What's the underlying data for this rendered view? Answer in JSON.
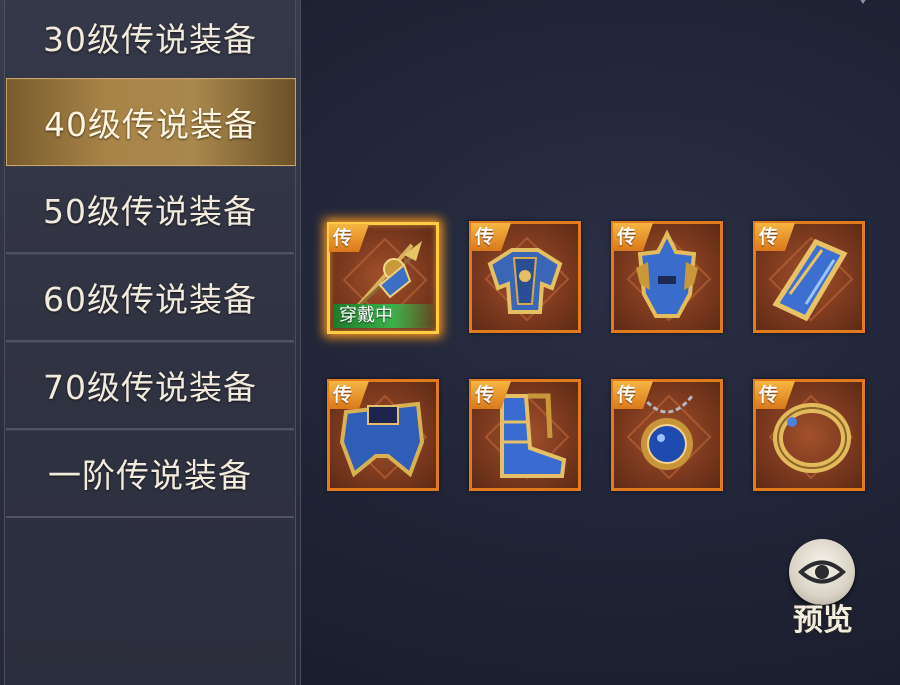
{
  "sidebar": {
    "items": [
      {
        "label": "30级传说装备",
        "selected": false
      },
      {
        "label": "40级传说装备",
        "selected": true
      },
      {
        "label": "50级传说装备",
        "selected": false
      },
      {
        "label": "60级传说装备",
        "selected": false
      },
      {
        "label": "70级传说装备",
        "selected": false
      },
      {
        "label": "一阶传说装备",
        "selected": false
      }
    ]
  },
  "equipment": {
    "badge_label": "传",
    "equipped_label": "穿戴中",
    "slots": [
      {
        "icon": "weapon-icon",
        "equipped": true
      },
      {
        "icon": "chest-armor-icon",
        "equipped": false
      },
      {
        "icon": "helmet-icon",
        "equipped": false
      },
      {
        "icon": "bracer-icon",
        "equipped": false
      },
      {
        "icon": "belt-icon",
        "equipped": false
      },
      {
        "icon": "boots-icon",
        "equipped": false
      },
      {
        "icon": "necklace-icon",
        "equipped": false
      },
      {
        "icon": "ring-icon",
        "equipped": false
      }
    ]
  },
  "preview": {
    "label": "预览",
    "icon": "eye-icon"
  },
  "colors": {
    "legend_orange": "#e27a1e",
    "selected_gold": "#a88448",
    "equipped_green": "#3bb04a"
  }
}
